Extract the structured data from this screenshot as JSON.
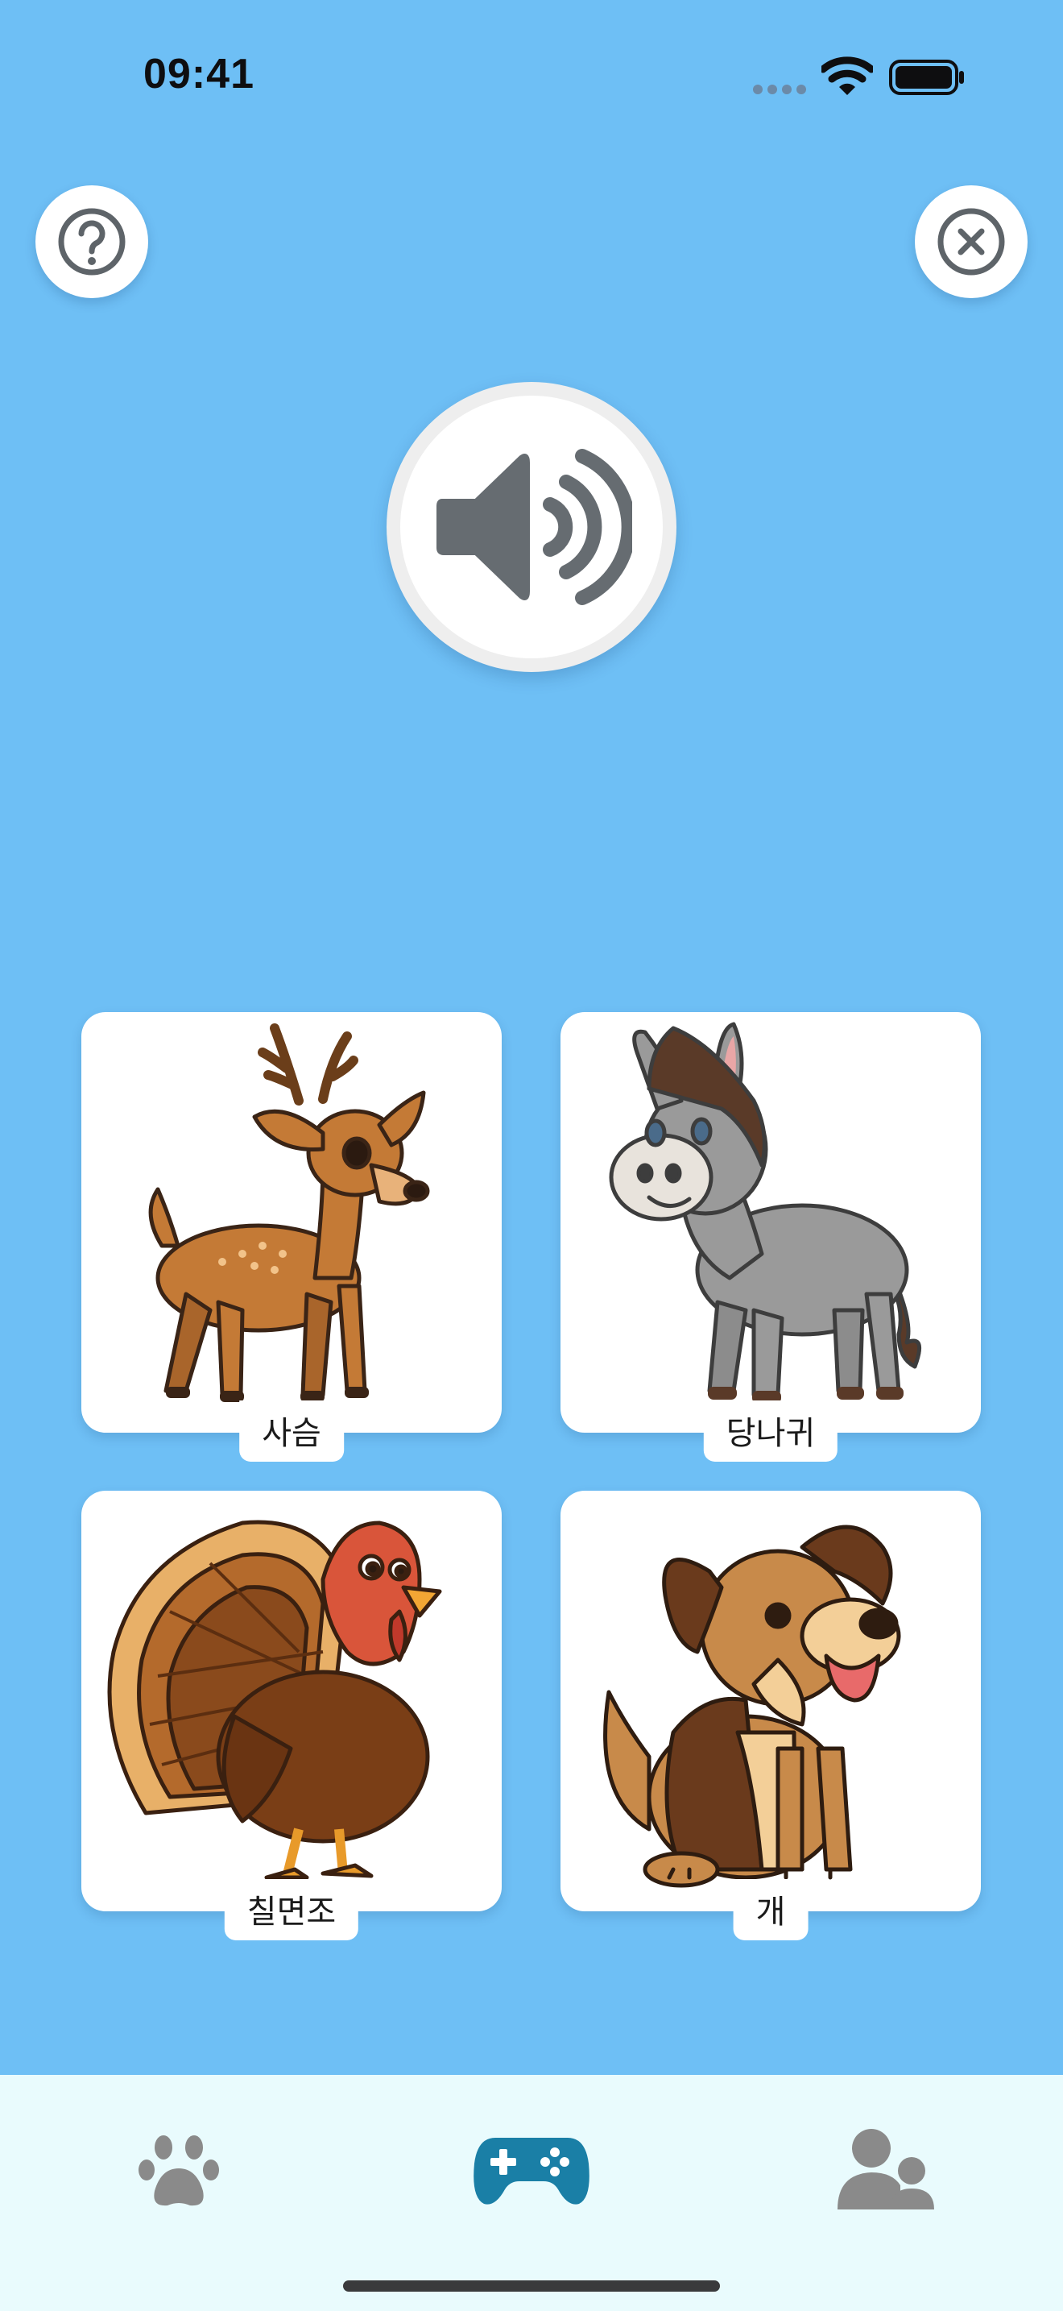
{
  "status_bar": {
    "time": "09:41"
  },
  "header": {
    "help_icon": "question-circle-icon",
    "close_icon": "close-circle-icon"
  },
  "sound_button": {
    "icon": "speaker-wave-icon"
  },
  "cards": [
    {
      "label": "사슴",
      "image": "deer"
    },
    {
      "label": "당나귀",
      "image": "donkey"
    },
    {
      "label": "칠면조",
      "image": "turkey"
    },
    {
      "label": "개",
      "image": "dog"
    }
  ],
  "tab_bar": {
    "tabs": [
      {
        "icon": "paw-icon",
        "active": false
      },
      {
        "icon": "gamepad-icon",
        "active": true
      },
      {
        "icon": "users-icon",
        "active": false
      }
    ],
    "active_color": "#1a7fa6",
    "inactive_color": "#8a8a8a"
  },
  "colors": {
    "background": "#6ebff5",
    "tab_bar_bg": "#e9fbfd"
  }
}
